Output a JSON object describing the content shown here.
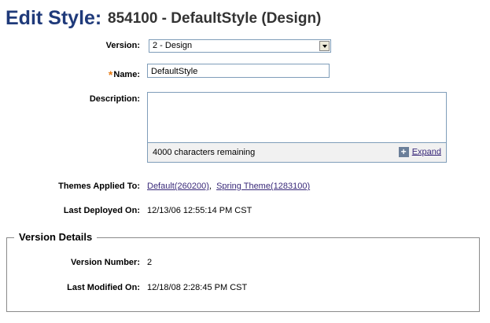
{
  "header": {
    "title": "Edit Style:",
    "subtitle": "854100 - DefaultStyle (Design)"
  },
  "form": {
    "version": {
      "label": "Version:",
      "value": "2 - Design"
    },
    "name": {
      "required_marker": "*",
      "label": "Name:",
      "value": "DefaultStyle"
    },
    "description": {
      "label": "Description:",
      "value": "",
      "remaining": "4000 characters remaining",
      "expand_label": "Expand"
    },
    "themes": {
      "label": "Themes Applied To:",
      "links": [
        "Default(260200)",
        "Spring Theme(1283100)"
      ],
      "separator": ","
    },
    "last_deployed": {
      "label": "Last Deployed On:",
      "value": "12/13/06 12:55:14 PM CST"
    }
  },
  "version_details": {
    "legend": "Version Details",
    "version_number": {
      "label": "Version Number:",
      "value": "2"
    },
    "last_modified": {
      "label": "Last Modified On:",
      "value": "12/18/08 2:28:45 PM CST"
    }
  },
  "colors": {
    "title": "#1f3a7a",
    "required": "#e87b13",
    "link": "#3a2a7a"
  }
}
